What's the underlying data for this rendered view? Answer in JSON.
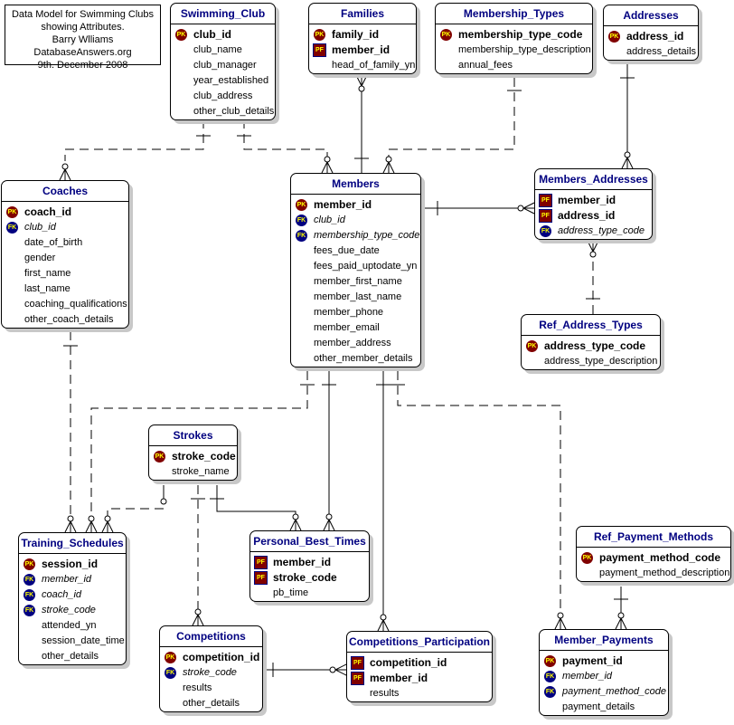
{
  "note": {
    "lines": [
      "Data Model for Swimming Clubs",
      "showing Attributes.",
      "Barry Wlliams",
      "DatabaseAnswers.org",
      "9th. December 2008"
    ]
  },
  "badge_labels": {
    "pk": "PK",
    "fk": "FK",
    "pf": "PF"
  },
  "colors": {
    "title": "#000080",
    "pk": "#800000",
    "fk": "#000080",
    "badge_text": "#ffff00",
    "shadow": "#c8c8c8"
  },
  "entities": {
    "swimming_club": {
      "title": "Swimming_Club",
      "attrs": [
        {
          "name": "club_id",
          "key": "pk"
        },
        {
          "name": "club_name",
          "key": ""
        },
        {
          "name": "club_manager",
          "key": ""
        },
        {
          "name": "year_established",
          "key": ""
        },
        {
          "name": "club_address",
          "key": ""
        },
        {
          "name": "other_club_details",
          "key": ""
        }
      ]
    },
    "families": {
      "title": "Families",
      "attrs": [
        {
          "name": "family_id",
          "key": "pk"
        },
        {
          "name": "member_id",
          "key": "pf"
        },
        {
          "name": "head_of_family_yn",
          "key": ""
        }
      ]
    },
    "membership_types": {
      "title": "Membership_Types",
      "attrs": [
        {
          "name": "membership_type_code",
          "key": "pk"
        },
        {
          "name": "membership_type_description",
          "key": ""
        },
        {
          "name": "annual_fees",
          "key": ""
        }
      ]
    },
    "addresses": {
      "title": "Addresses",
      "attrs": [
        {
          "name": "address_id",
          "key": "pk"
        },
        {
          "name": "address_details",
          "key": ""
        }
      ]
    },
    "coaches": {
      "title": "Coaches",
      "attrs": [
        {
          "name": "coach_id",
          "key": "pk"
        },
        {
          "name": "club_id",
          "key": "fk"
        },
        {
          "name": "date_of_birth",
          "key": ""
        },
        {
          "name": "gender",
          "key": ""
        },
        {
          "name": "first_name",
          "key": ""
        },
        {
          "name": "last_name",
          "key": ""
        },
        {
          "name": "coaching_qualifications",
          "key": ""
        },
        {
          "name": "other_coach_details",
          "key": ""
        }
      ]
    },
    "members": {
      "title": "Members",
      "attrs": [
        {
          "name": "member_id",
          "key": "pk"
        },
        {
          "name": "club_id",
          "key": "fk"
        },
        {
          "name": "membership_type_code",
          "key": "fk"
        },
        {
          "name": "fees_due_date",
          "key": ""
        },
        {
          "name": "fees_paid_uptodate_yn",
          "key": ""
        },
        {
          "name": "member_first_name",
          "key": ""
        },
        {
          "name": "member_last_name",
          "key": ""
        },
        {
          "name": "member_phone",
          "key": ""
        },
        {
          "name": "member_email",
          "key": ""
        },
        {
          "name": "member_address",
          "key": ""
        },
        {
          "name": "other_member_details",
          "key": ""
        }
      ]
    },
    "members_addresses": {
      "title": "Members_Addresses",
      "attrs": [
        {
          "name": "member_id",
          "key": "pf"
        },
        {
          "name": "address_id",
          "key": "pf"
        },
        {
          "name": "address_type_code",
          "key": "fk"
        }
      ]
    },
    "ref_address_types": {
      "title": "Ref_Address_Types",
      "attrs": [
        {
          "name": "address_type_code",
          "key": "pk"
        },
        {
          "name": "address_type_description",
          "key": ""
        }
      ]
    },
    "strokes": {
      "title": "Strokes",
      "attrs": [
        {
          "name": "stroke_code",
          "key": "pk"
        },
        {
          "name": "stroke_name",
          "key": ""
        }
      ]
    },
    "training_schedules": {
      "title": "Training_Schedules",
      "attrs": [
        {
          "name": "session_id",
          "key": "pk"
        },
        {
          "name": "member_id",
          "key": "fk"
        },
        {
          "name": "coach_id",
          "key": "fk"
        },
        {
          "name": "stroke_code",
          "key": "fk"
        },
        {
          "name": "attended_yn",
          "key": ""
        },
        {
          "name": "session_date_time",
          "key": ""
        },
        {
          "name": "other_details",
          "key": ""
        }
      ]
    },
    "personal_best_times": {
      "title": "Personal_Best_Times",
      "attrs": [
        {
          "name": "member_id",
          "key": "pf"
        },
        {
          "name": "stroke_code",
          "key": "pf"
        },
        {
          "name": "pb_time",
          "key": ""
        }
      ]
    },
    "competitions": {
      "title": "Competitions",
      "attrs": [
        {
          "name": "competition_id",
          "key": "pk"
        },
        {
          "name": "stroke_code",
          "key": "fk"
        },
        {
          "name": "results",
          "key": ""
        },
        {
          "name": "other_details",
          "key": ""
        }
      ]
    },
    "competitions_participation": {
      "title": "Competitions_Participation",
      "attrs": [
        {
          "name": "competition_id",
          "key": "pf"
        },
        {
          "name": "member_id",
          "key": "pf"
        },
        {
          "name": "results",
          "key": ""
        }
      ]
    },
    "ref_payment_methods": {
      "title": "Ref_Payment_Methods",
      "attrs": [
        {
          "name": "payment_method_code",
          "key": "pk"
        },
        {
          "name": "payment_method_description",
          "key": ""
        }
      ]
    },
    "member_payments": {
      "title": "Member_Payments",
      "attrs": [
        {
          "name": "payment_id",
          "key": "pk"
        },
        {
          "name": "member_id",
          "key": "fk"
        },
        {
          "name": "payment_method_code",
          "key": "fk"
        },
        {
          "name": "payment_details",
          "key": ""
        }
      ]
    }
  },
  "relationships": [
    {
      "from": "swimming_club",
      "to": "coaches",
      "identifying": false
    },
    {
      "from": "swimming_club",
      "to": "members",
      "identifying": false
    },
    {
      "from": "members",
      "to": "families",
      "identifying": true
    },
    {
      "from": "membership_types",
      "to": "members",
      "identifying": false
    },
    {
      "from": "members",
      "to": "members_addresses",
      "identifying": true
    },
    {
      "from": "addresses",
      "to": "members_addresses",
      "identifying": true
    },
    {
      "from": "ref_address_types",
      "to": "members_addresses",
      "identifying": false
    },
    {
      "from": "coaches",
      "to": "training_schedules",
      "identifying": false
    },
    {
      "from": "members",
      "to": "training_schedules",
      "identifying": false
    },
    {
      "from": "strokes",
      "to": "training_schedules",
      "identifying": false
    },
    {
      "from": "members",
      "to": "personal_best_times",
      "identifying": true
    },
    {
      "from": "strokes",
      "to": "personal_best_times",
      "identifying": true
    },
    {
      "from": "strokes",
      "to": "competitions",
      "identifying": false
    },
    {
      "from": "members",
      "to": "competitions_participation",
      "identifying": true
    },
    {
      "from": "competitions",
      "to": "competitions_participation",
      "identifying": true
    },
    {
      "from": "members",
      "to": "member_payments",
      "identifying": false
    },
    {
      "from": "ref_payment_methods",
      "to": "member_payments",
      "identifying": false
    }
  ]
}
